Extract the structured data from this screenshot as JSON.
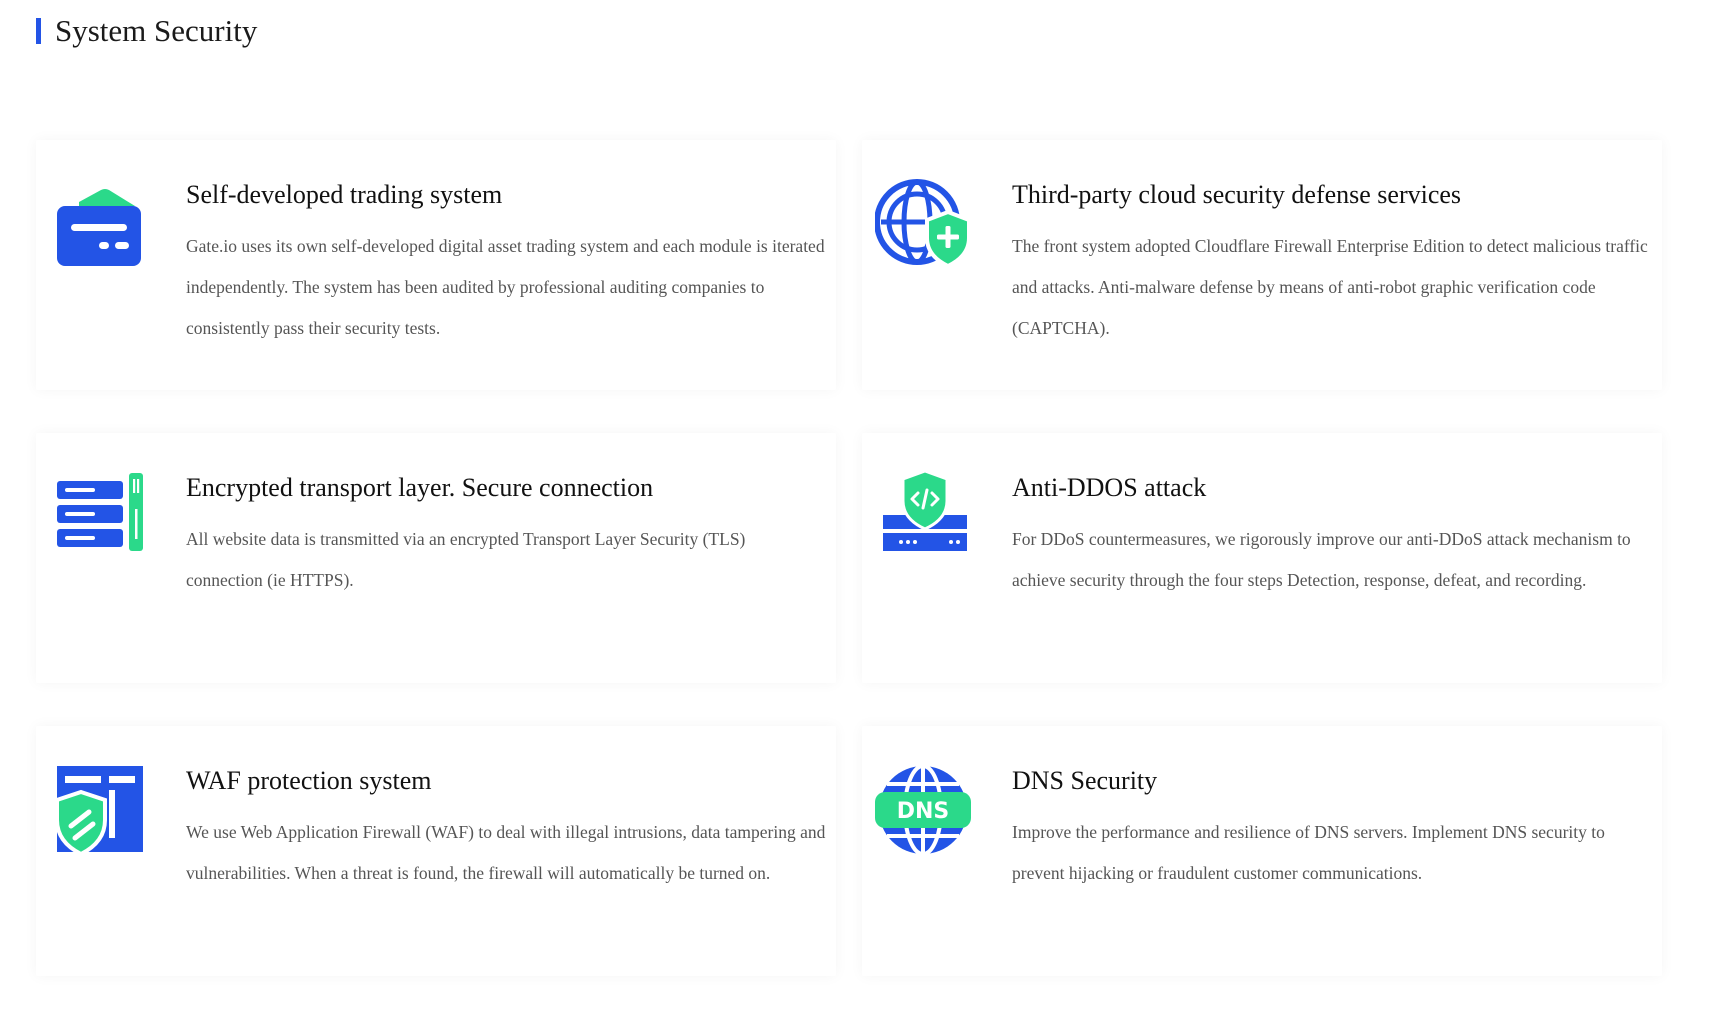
{
  "header": {
    "title": "System Security",
    "accent_color": "#2354e6"
  },
  "colors": {
    "primary_blue": "#2354e6",
    "accent_green": "#2bd98a"
  },
  "cards": [
    {
      "icon": "card-wallet-icon",
      "title": "Self-developed trading system",
      "description": "Gate.io uses its own self-developed digital asset trading system and each module is iterated independently. The system has been audited by professional auditing companies to consistently pass their security tests."
    },
    {
      "icon": "globe-shield-plus-icon",
      "title": "Third-party cloud security defense services",
      "description": "The front system adopted Cloudflare Firewall Enterprise Edition to detect malicious traffic and attacks. Anti-malware defense by means of anti-robot graphic verification code (CAPTCHA)."
    },
    {
      "icon": "server-stack-icon",
      "title": "Encrypted transport layer. Secure connection",
      "description": "All website data is transmitted via an encrypted Transport Layer Security (TLS) connection (ie HTTPS)."
    },
    {
      "icon": "code-shield-server-icon",
      "title": "Anti-DDOS attack",
      "description": "For DDoS countermeasures, we rigorously improve our anti-DDoS attack mechanism to achieve security through the four steps Detection, response, defeat, and recording."
    },
    {
      "icon": "firewall-shield-icon",
      "title": "WAF protection system",
      "description": "We use Web Application Firewall (WAF) to deal with illegal intrusions, data tampering and vulnerabilities. When a threat is found, the firewall will automatically be turned on."
    },
    {
      "icon": "dns-globe-icon",
      "title": "DNS Security",
      "description": "Improve the performance and resilience of DNS servers. Implement DNS security to prevent hijacking or fraudulent customer communications.",
      "icon_text": "DNS"
    }
  ]
}
